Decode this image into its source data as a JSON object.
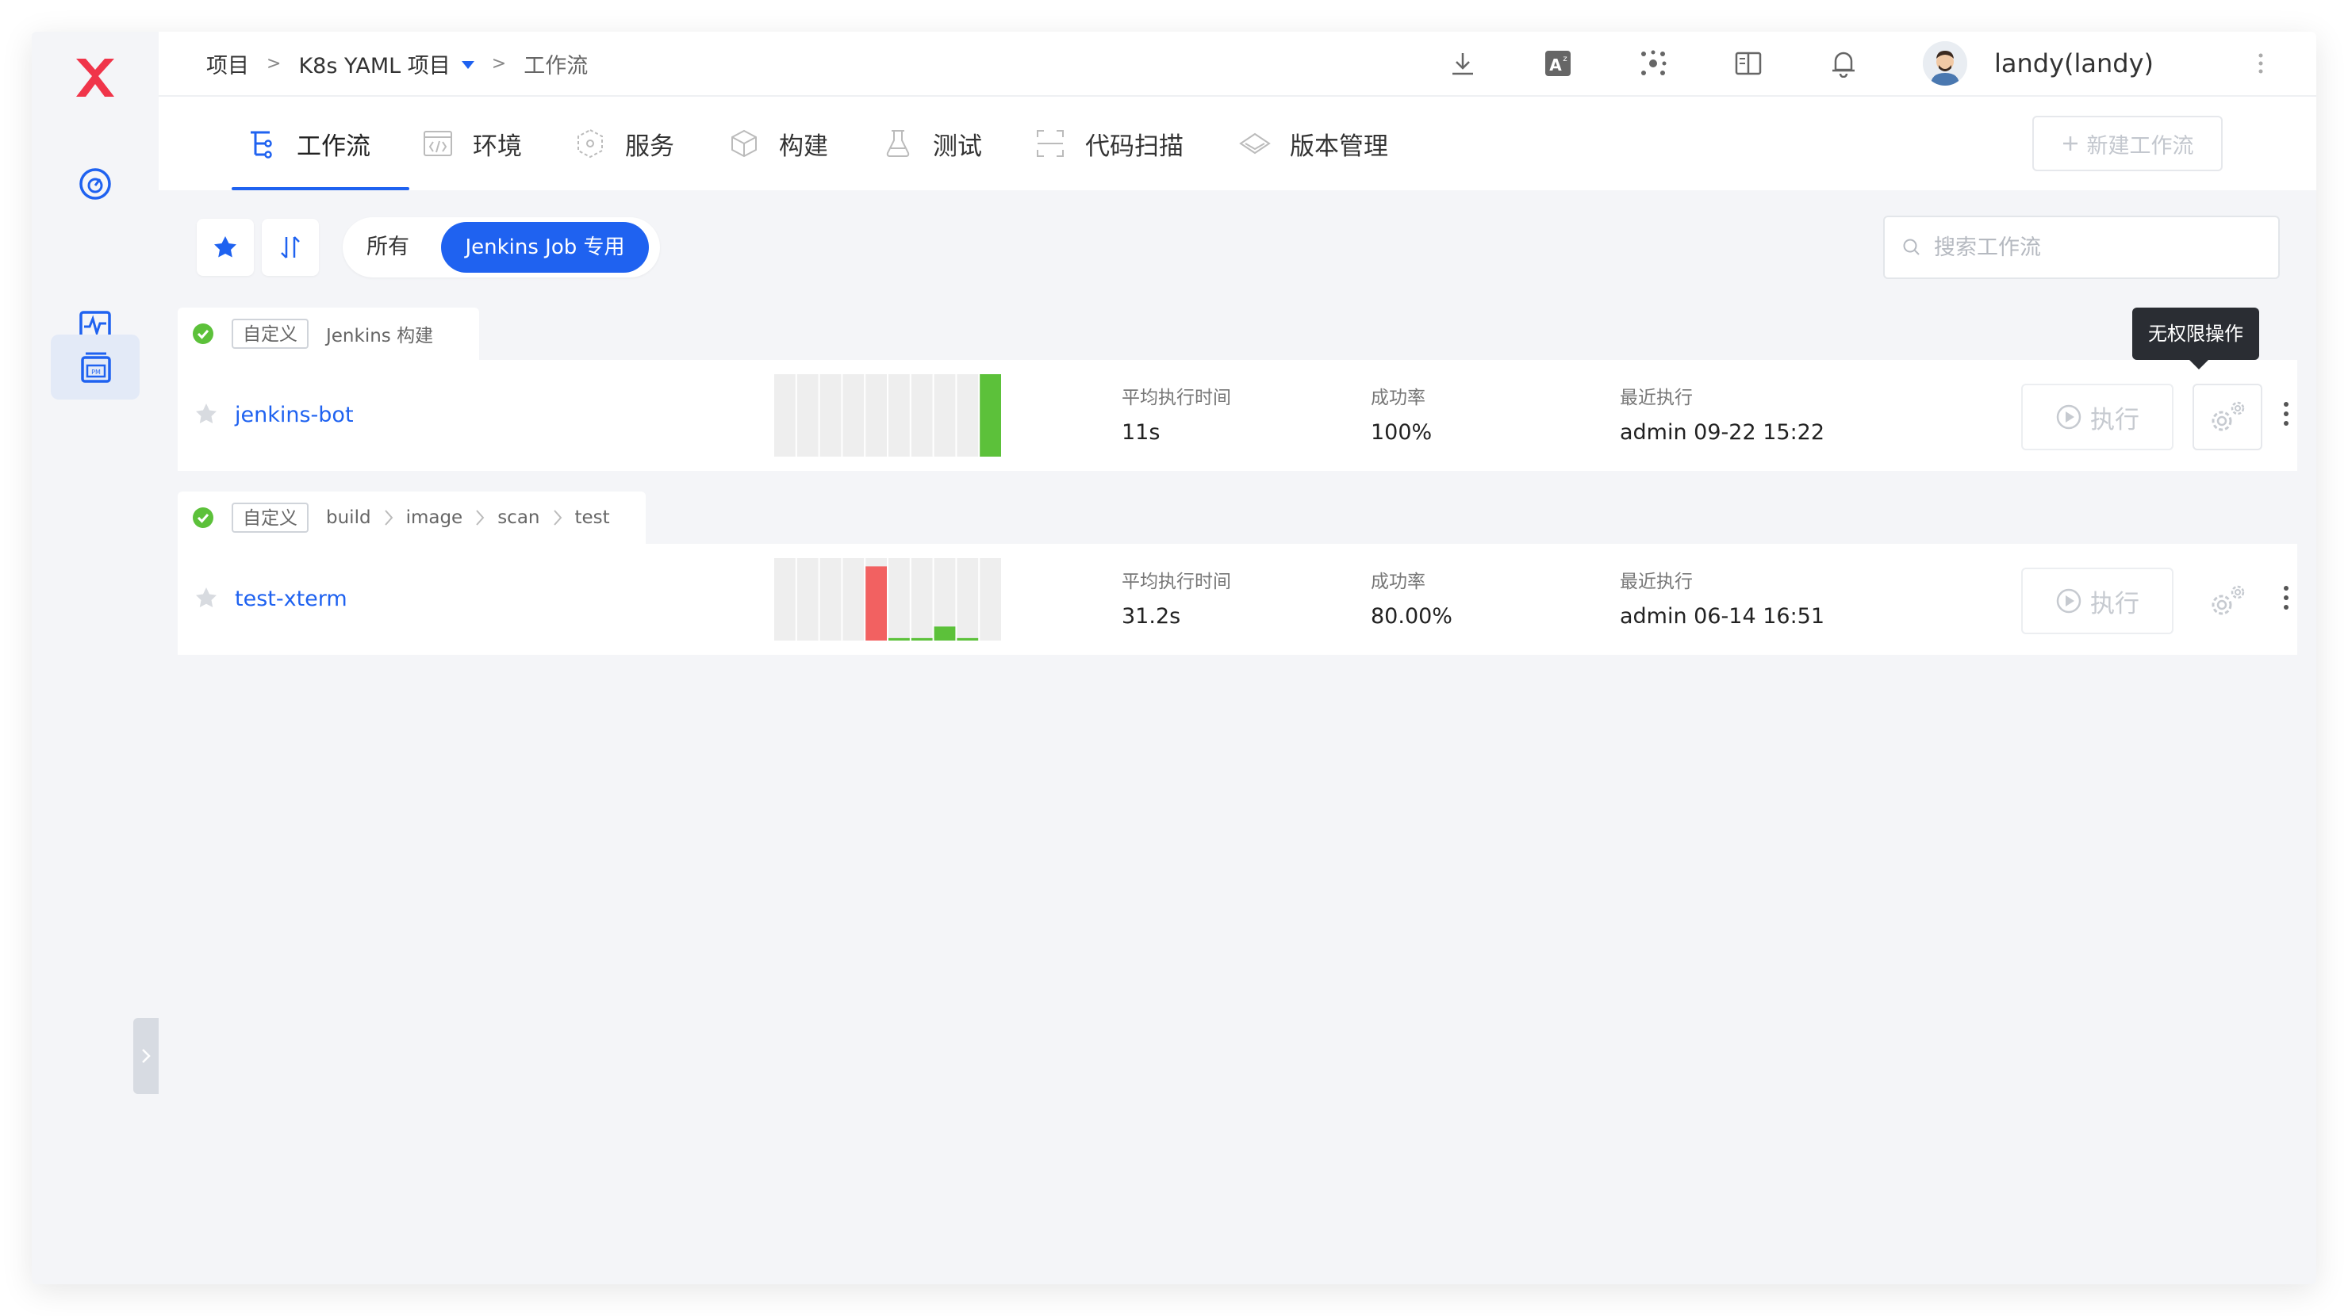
{
  "breadcrumb": {
    "root": "项目",
    "project": "K8s YAML 项目",
    "current": "工作流",
    "separator": ">"
  },
  "user": {
    "name": "landy(landy)"
  },
  "tabs": [
    {
      "label": "工作流",
      "icon": "workflow-icon",
      "active": true
    },
    {
      "label": "环境",
      "icon": "environment-icon"
    },
    {
      "label": "服务",
      "icon": "service-icon"
    },
    {
      "label": "构建",
      "icon": "build-icon"
    },
    {
      "label": "测试",
      "icon": "test-icon"
    },
    {
      "label": "代码扫描",
      "icon": "code-scan-icon"
    },
    {
      "label": "版本管理",
      "icon": "version-icon"
    }
  ],
  "toolbar": {
    "new_workflow": "新建工作流",
    "filter_all": "所有",
    "filter_active": "Jenkins Job 专用",
    "search_placeholder": "搜索工作流"
  },
  "tooltip": {
    "text": "无权限操作"
  },
  "workflows": [
    {
      "tag": "自定义",
      "stages": [
        "Jenkins 构建"
      ],
      "name": "jenkins-bot",
      "avg_time_label": "平均执行时间",
      "avg_time": "11s",
      "success_label": "成功率",
      "success_rate": "100%",
      "recent_label": "最近执行",
      "recent": "admin 09-22 15:22",
      "run_label": "执行",
      "history": [
        0,
        0,
        0,
        0,
        0,
        0,
        0,
        0,
        0,
        1.0
      ],
      "history_status": [
        "none",
        "none",
        "none",
        "none",
        "none",
        "none",
        "none",
        "none",
        "none",
        "success"
      ]
    },
    {
      "tag": "自定义",
      "stages": [
        "build",
        "image",
        "scan",
        "test"
      ],
      "name": "test-xterm",
      "avg_time_label": "平均执行时间",
      "avg_time": "31.2s",
      "success_label": "成功率",
      "success_rate": "80.00%",
      "recent_label": "最近执行",
      "recent": "admin 06-14 16:51",
      "run_label": "执行",
      "history": [
        0,
        0,
        0,
        0,
        0.9,
        0.03,
        0.03,
        0.17,
        0.03,
        0
      ],
      "history_status": [
        "none",
        "none",
        "none",
        "none",
        "failed",
        "success",
        "success",
        "success",
        "success",
        "none"
      ]
    }
  ],
  "colors": {
    "accent": "#1f62f0",
    "success": "#5cc13a",
    "failed": "#f26161",
    "bar_bg": "#eeeeee",
    "logo": "#f0354a"
  }
}
